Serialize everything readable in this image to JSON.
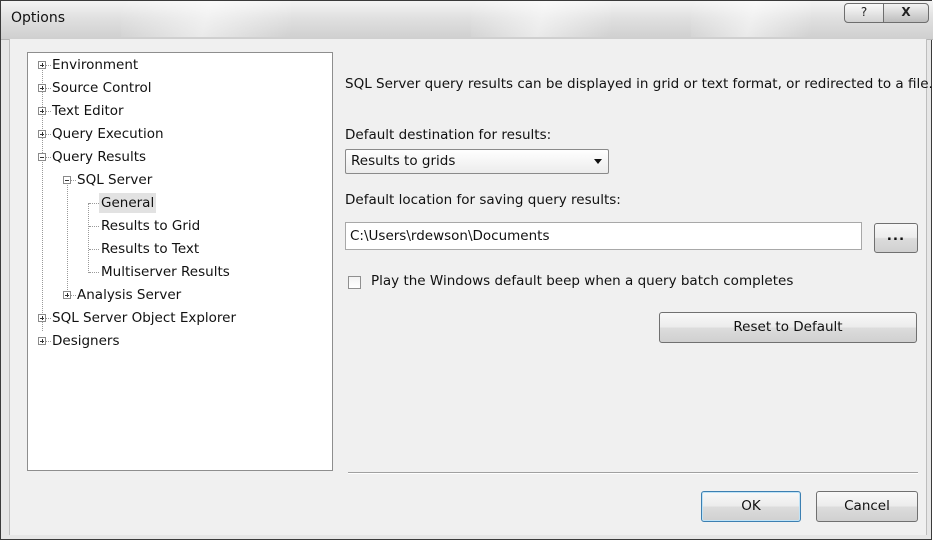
{
  "window": {
    "title": "Options",
    "help_label": "?",
    "close_label": "X"
  },
  "tree": {
    "items": [
      {
        "label": "Environment",
        "expander": "plus"
      },
      {
        "label": "Source Control",
        "expander": "plus"
      },
      {
        "label": "Text Editor",
        "expander": "plus"
      },
      {
        "label": "Query Execution",
        "expander": "plus"
      },
      {
        "label": "Query Results",
        "expander": "minus"
      },
      {
        "label": "SQL Server",
        "expander": "minus"
      },
      {
        "label": "General",
        "selected": true
      },
      {
        "label": "Results to Grid"
      },
      {
        "label": "Results to Text"
      },
      {
        "label": "Multiserver Results"
      },
      {
        "label": "Analysis Server",
        "expander": "plus"
      },
      {
        "label": "SQL Server Object Explorer",
        "expander": "plus"
      },
      {
        "label": "Designers",
        "expander": "plus"
      }
    ]
  },
  "panel": {
    "description": "SQL Server query results can be displayed in grid or text format, or redirected to a file.",
    "destination_label": "Default destination for results:",
    "destination_value": "Results to grids",
    "location_label": "Default location for saving query results:",
    "location_value": "C:\\Users\\rdewson\\Documents",
    "browse_label": "...",
    "beep_label": "Play the Windows default beep when a query batch completes",
    "beep_checked": false,
    "reset_label": "Reset to Default"
  },
  "footer": {
    "ok_label": "OK",
    "cancel_label": "Cancel"
  }
}
